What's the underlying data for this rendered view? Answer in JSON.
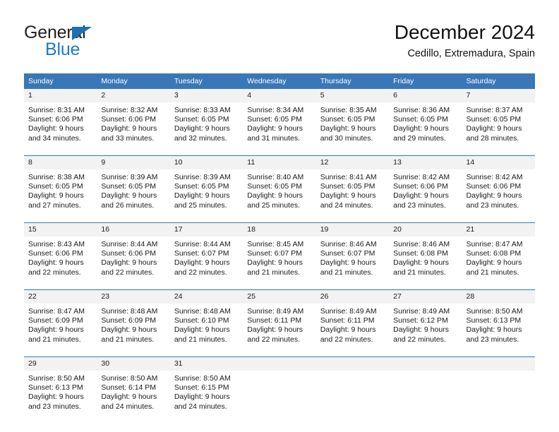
{
  "brand": {
    "name_top": "General",
    "name_bottom": "Blue",
    "triangle_icon": "blue-triangle-logo-mark",
    "color_top": "#231f20",
    "color_bottom": "#1d79c4"
  },
  "header": {
    "title": "December 2024",
    "subtitle": "Cedillo, Extremadura, Spain"
  },
  "theme": {
    "header_blue": "#3a77b8",
    "daynum_band": "#f2f2f2",
    "text": "#1a1a1a"
  },
  "calendar": {
    "weekday_headers": [
      "Sunday",
      "Monday",
      "Tuesday",
      "Wednesday",
      "Thursday",
      "Friday",
      "Saturday"
    ],
    "weeks": [
      [
        {
          "day": "1",
          "sunrise": "Sunrise: 8:31 AM",
          "sunset": "Sunset: 6:06 PM",
          "daylight1": "Daylight: 9 hours",
          "daylight2": "and 34 minutes."
        },
        {
          "day": "2",
          "sunrise": "Sunrise: 8:32 AM",
          "sunset": "Sunset: 6:06 PM",
          "daylight1": "Daylight: 9 hours",
          "daylight2": "and 33 minutes."
        },
        {
          "day": "3",
          "sunrise": "Sunrise: 8:33 AM",
          "sunset": "Sunset: 6:05 PM",
          "daylight1": "Daylight: 9 hours",
          "daylight2": "and 32 minutes."
        },
        {
          "day": "4",
          "sunrise": "Sunrise: 8:34 AM",
          "sunset": "Sunset: 6:05 PM",
          "daylight1": "Daylight: 9 hours",
          "daylight2": "and 31 minutes."
        },
        {
          "day": "5",
          "sunrise": "Sunrise: 8:35 AM",
          "sunset": "Sunset: 6:05 PM",
          "daylight1": "Daylight: 9 hours",
          "daylight2": "and 30 minutes."
        },
        {
          "day": "6",
          "sunrise": "Sunrise: 8:36 AM",
          "sunset": "Sunset: 6:05 PM",
          "daylight1": "Daylight: 9 hours",
          "daylight2": "and 29 minutes."
        },
        {
          "day": "7",
          "sunrise": "Sunrise: 8:37 AM",
          "sunset": "Sunset: 6:05 PM",
          "daylight1": "Daylight: 9 hours",
          "daylight2": "and 28 minutes."
        }
      ],
      [
        {
          "day": "8",
          "sunrise": "Sunrise: 8:38 AM",
          "sunset": "Sunset: 6:05 PM",
          "daylight1": "Daylight: 9 hours",
          "daylight2": "and 27 minutes."
        },
        {
          "day": "9",
          "sunrise": "Sunrise: 8:39 AM",
          "sunset": "Sunset: 6:05 PM",
          "daylight1": "Daylight: 9 hours",
          "daylight2": "and 26 minutes."
        },
        {
          "day": "10",
          "sunrise": "Sunrise: 8:39 AM",
          "sunset": "Sunset: 6:05 PM",
          "daylight1": "Daylight: 9 hours",
          "daylight2": "and 25 minutes."
        },
        {
          "day": "11",
          "sunrise": "Sunrise: 8:40 AM",
          "sunset": "Sunset: 6:05 PM",
          "daylight1": "Daylight: 9 hours",
          "daylight2": "and 25 minutes."
        },
        {
          "day": "12",
          "sunrise": "Sunrise: 8:41 AM",
          "sunset": "Sunset: 6:05 PM",
          "daylight1": "Daylight: 9 hours",
          "daylight2": "and 24 minutes."
        },
        {
          "day": "13",
          "sunrise": "Sunrise: 8:42 AM",
          "sunset": "Sunset: 6:06 PM",
          "daylight1": "Daylight: 9 hours",
          "daylight2": "and 23 minutes."
        },
        {
          "day": "14",
          "sunrise": "Sunrise: 8:42 AM",
          "sunset": "Sunset: 6:06 PM",
          "daylight1": "Daylight: 9 hours",
          "daylight2": "and 23 minutes."
        }
      ],
      [
        {
          "day": "15",
          "sunrise": "Sunrise: 8:43 AM",
          "sunset": "Sunset: 6:06 PM",
          "daylight1": "Daylight: 9 hours",
          "daylight2": "and 22 minutes."
        },
        {
          "day": "16",
          "sunrise": "Sunrise: 8:44 AM",
          "sunset": "Sunset: 6:06 PM",
          "daylight1": "Daylight: 9 hours",
          "daylight2": "and 22 minutes."
        },
        {
          "day": "17",
          "sunrise": "Sunrise: 8:44 AM",
          "sunset": "Sunset: 6:07 PM",
          "daylight1": "Daylight: 9 hours",
          "daylight2": "and 22 minutes."
        },
        {
          "day": "18",
          "sunrise": "Sunrise: 8:45 AM",
          "sunset": "Sunset: 6:07 PM",
          "daylight1": "Daylight: 9 hours",
          "daylight2": "and 21 minutes."
        },
        {
          "day": "19",
          "sunrise": "Sunrise: 8:46 AM",
          "sunset": "Sunset: 6:07 PM",
          "daylight1": "Daylight: 9 hours",
          "daylight2": "and 21 minutes."
        },
        {
          "day": "20",
          "sunrise": "Sunrise: 8:46 AM",
          "sunset": "Sunset: 6:08 PM",
          "daylight1": "Daylight: 9 hours",
          "daylight2": "and 21 minutes."
        },
        {
          "day": "21",
          "sunrise": "Sunrise: 8:47 AM",
          "sunset": "Sunset: 6:08 PM",
          "daylight1": "Daylight: 9 hours",
          "daylight2": "and 21 minutes."
        }
      ],
      [
        {
          "day": "22",
          "sunrise": "Sunrise: 8:47 AM",
          "sunset": "Sunset: 6:09 PM",
          "daylight1": "Daylight: 9 hours",
          "daylight2": "and 21 minutes."
        },
        {
          "day": "23",
          "sunrise": "Sunrise: 8:48 AM",
          "sunset": "Sunset: 6:09 PM",
          "daylight1": "Daylight: 9 hours",
          "daylight2": "and 21 minutes."
        },
        {
          "day": "24",
          "sunrise": "Sunrise: 8:48 AM",
          "sunset": "Sunset: 6:10 PM",
          "daylight1": "Daylight: 9 hours",
          "daylight2": "and 21 minutes."
        },
        {
          "day": "25",
          "sunrise": "Sunrise: 8:49 AM",
          "sunset": "Sunset: 6:11 PM",
          "daylight1": "Daylight: 9 hours",
          "daylight2": "and 22 minutes."
        },
        {
          "day": "26",
          "sunrise": "Sunrise: 8:49 AM",
          "sunset": "Sunset: 6:11 PM",
          "daylight1": "Daylight: 9 hours",
          "daylight2": "and 22 minutes."
        },
        {
          "day": "27",
          "sunrise": "Sunrise: 8:49 AM",
          "sunset": "Sunset: 6:12 PM",
          "daylight1": "Daylight: 9 hours",
          "daylight2": "and 22 minutes."
        },
        {
          "day": "28",
          "sunrise": "Sunrise: 8:50 AM",
          "sunset": "Sunset: 6:13 PM",
          "daylight1": "Daylight: 9 hours",
          "daylight2": "and 23 minutes."
        }
      ],
      [
        {
          "day": "29",
          "sunrise": "Sunrise: 8:50 AM",
          "sunset": "Sunset: 6:13 PM",
          "daylight1": "Daylight: 9 hours",
          "daylight2": "and 23 minutes."
        },
        {
          "day": "30",
          "sunrise": "Sunrise: 8:50 AM",
          "sunset": "Sunset: 6:14 PM",
          "daylight1": "Daylight: 9 hours",
          "daylight2": "and 24 minutes."
        },
        {
          "day": "31",
          "sunrise": "Sunrise: 8:50 AM",
          "sunset": "Sunset: 6:15 PM",
          "daylight1": "Daylight: 9 hours",
          "daylight2": "and 24 minutes."
        },
        {
          "day": "",
          "sunrise": "",
          "sunset": "",
          "daylight1": "",
          "daylight2": ""
        },
        {
          "day": "",
          "sunrise": "",
          "sunset": "",
          "daylight1": "",
          "daylight2": ""
        },
        {
          "day": "",
          "sunrise": "",
          "sunset": "",
          "daylight1": "",
          "daylight2": ""
        },
        {
          "day": "",
          "sunrise": "",
          "sunset": "",
          "daylight1": "",
          "daylight2": ""
        }
      ]
    ]
  }
}
